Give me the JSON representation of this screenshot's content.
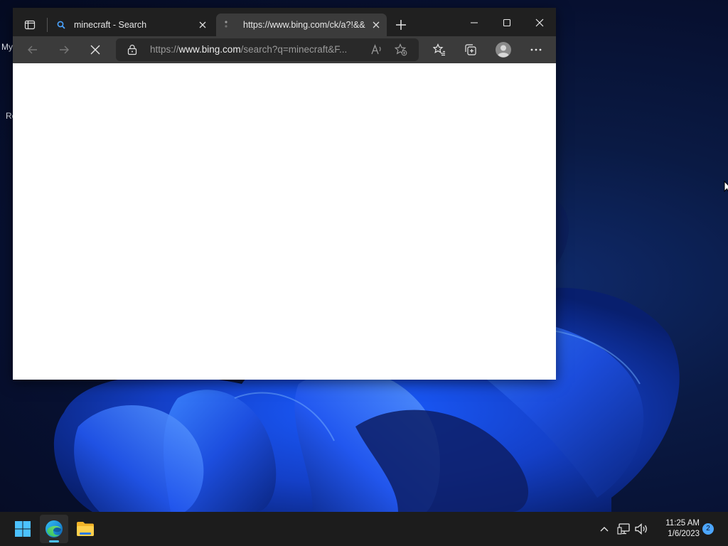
{
  "desktop": {
    "icon_labels": [
      "My",
      "Re"
    ]
  },
  "browser": {
    "tabs": [
      {
        "title": "minecraft - Search",
        "favicon": "search-icon",
        "active": false
      },
      {
        "title": "https://www.bing.com/ck/a?!&&",
        "favicon": "loading-icon",
        "active": true
      }
    ],
    "address_bar": {
      "url_prefix": "https://",
      "url_domain": "www.bing.com",
      "url_rest": "/search?q=minecraft&F..."
    },
    "toolbar_icons": [
      "back-icon",
      "forward-icon",
      "stop-icon",
      "lock-icon",
      "read-aloud-icon",
      "add-favorite-icon",
      "favorites-icon",
      "collections-icon",
      "profile-icon",
      "more-icon"
    ]
  },
  "taskbar": {
    "time": "11:25 AM",
    "date": "1/6/2023",
    "notification_count": "2",
    "apps": [
      "start-icon",
      "edge-icon",
      "file-explorer-icon"
    ],
    "accent_color": "#4cc2ff"
  }
}
